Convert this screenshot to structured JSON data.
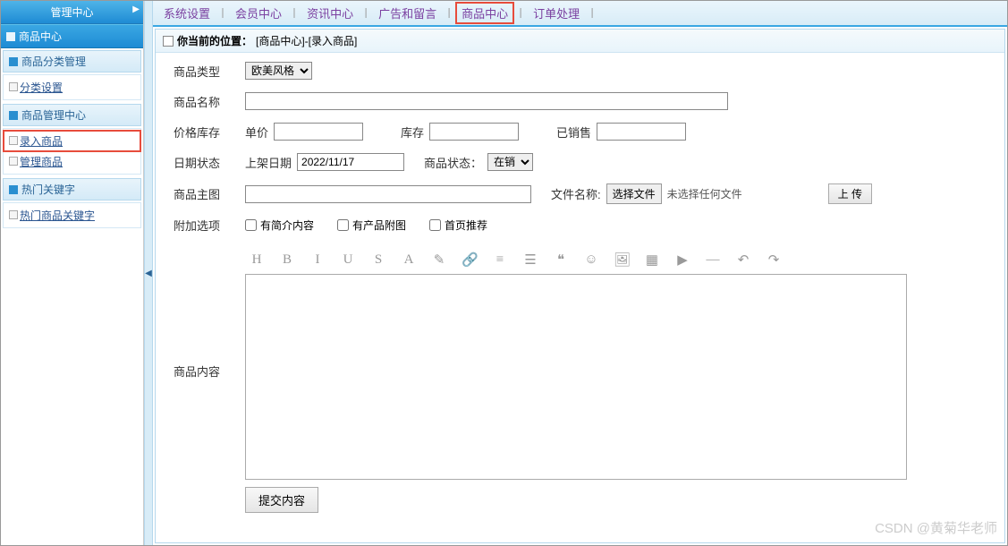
{
  "sidebar": {
    "header": "管理中心",
    "main_section": "商品中心",
    "groups": [
      {
        "title": "商品分类管理",
        "items": [
          {
            "label": "分类设置",
            "highlighted": false
          }
        ]
      },
      {
        "title": "商品管理中心",
        "items": [
          {
            "label": "录入商品",
            "highlighted": true
          },
          {
            "label": "管理商品",
            "highlighted": false
          }
        ]
      },
      {
        "title": "热门关键字",
        "items": [
          {
            "label": "热门商品关键字",
            "highlighted": false
          }
        ]
      }
    ]
  },
  "topnav": {
    "items": [
      {
        "label": "系统设置",
        "highlighted": false
      },
      {
        "label": "会员中心",
        "highlighted": false
      },
      {
        "label": "资讯中心",
        "highlighted": false
      },
      {
        "label": "广告和留言",
        "highlighted": false
      },
      {
        "label": "商品中心",
        "highlighted": true
      },
      {
        "label": "订单处理",
        "highlighted": false
      }
    ]
  },
  "breadcrumb": {
    "prefix": "你当前的位置：",
    "path": "[商品中心]-[录入商品]"
  },
  "form": {
    "type_label": "商品类型",
    "type_select": "欧美风格",
    "name_label": "商品名称",
    "name_value": "",
    "price_stock_label": "价格库存",
    "price_label": "单价",
    "price_value": "",
    "stock_label": "库存",
    "stock_value": "",
    "sold_label": "已销售",
    "sold_value": "",
    "date_status_label": "日期状态",
    "onshelf_label": "上架日期",
    "onshelf_value": "2022/11/17",
    "status_label": "商品状态：",
    "status_select": "在销",
    "main_img_label": "商品主图",
    "main_img_value": "",
    "file_name_label": "文件名称:",
    "file_choose_btn": "选择文件",
    "file_status": "未选择任何文件",
    "upload_btn": "上 传",
    "extra_label": "附加选项",
    "cb_intro": "有简介内容",
    "cb_attach": "有产品附图",
    "cb_home": "首页推荐",
    "content_label": "商品内容",
    "submit_btn": "提交内容"
  },
  "editor_toolbar": [
    "H",
    "B",
    "I",
    "U",
    "S",
    "A",
    "✎",
    "🔗",
    "≡",
    "☰",
    "❝",
    "☺",
    "🖼",
    "▦",
    "▶",
    "—",
    "↶",
    "↷"
  ],
  "watermark": "CSDN @黄菊华老师"
}
